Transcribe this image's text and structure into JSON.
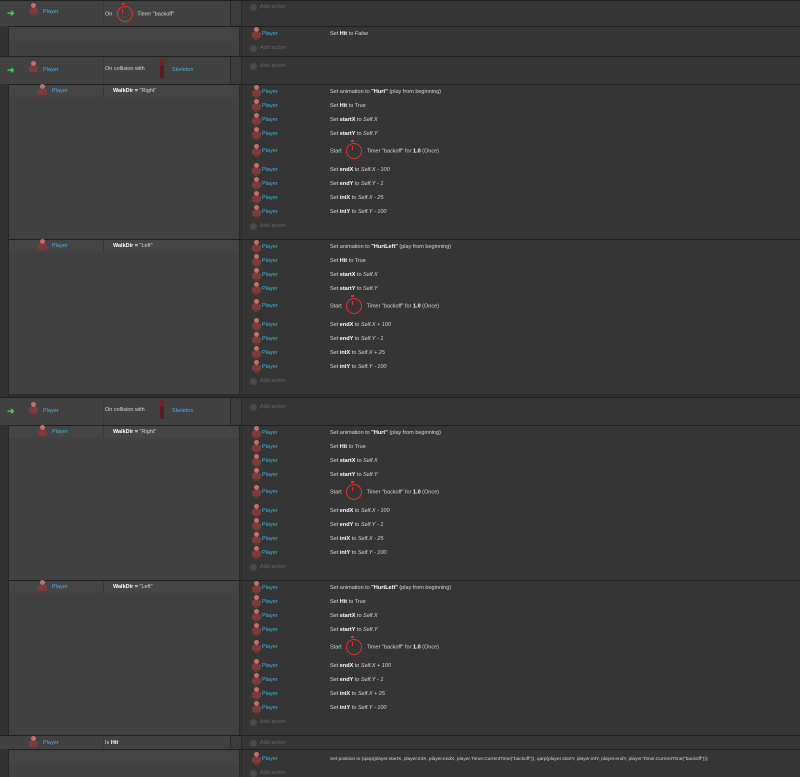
{
  "add_action": "Add action",
  "object": "Player",
  "events": [
    {
      "type": "timer",
      "on": "On",
      "timer_text": "Timer \"backoff\"",
      "actions": [],
      "subevents": [
        {
          "condition": "",
          "actions": [
            {
              "object": "Player",
              "pre": "Set ",
              "b": "Hit",
              "mid": " to ",
              "i": "False"
            }
          ]
        }
      ]
    },
    {
      "type": "collision",
      "condition": "On collision with",
      "target": "Skeleton",
      "subevents": [
        {
          "condition_pre": "WalkDir = ",
          "condition_val": "\"Right\"",
          "anim": "Hurt"
        },
        {
          "condition_pre": "WalkDir = ",
          "condition_val": "\"Left\"",
          "anim": "HurtLeft"
        }
      ]
    },
    {
      "type": "collision",
      "condition": "On collision with",
      "target": "Skeleton",
      "subevents": [
        {
          "condition_pre": "WalkDir = ",
          "condition_val": "\"Right\"",
          "anim": "Hurt"
        },
        {
          "condition_pre": "WalkDir = ",
          "condition_val": "\"Left\"",
          "anim": "HurtLeft"
        }
      ]
    }
  ],
  "right_actions": [
    {
      "pre": "Set animation to ",
      "b": "\"Hurt\"",
      "post": " (play from beginning)"
    },
    {
      "pre": "Set ",
      "b": "Hit",
      "post": " to True"
    },
    {
      "pre": "Set ",
      "b": "startX",
      "post": " to ",
      "i": "Self.X"
    },
    {
      "pre": "Set ",
      "b": "startY",
      "post": " to ",
      "i": "Self.Y"
    },
    {
      "timer": true,
      "pre": "Start ",
      "post": " Timer \"backoff\" for ",
      "b": "1.0",
      "post2": " (Once)"
    },
    {
      "pre": "Set ",
      "b": "endX",
      "post": " to ",
      "i": "Self.X - 100"
    },
    {
      "pre": "Set ",
      "b": "endY",
      "post": " to ",
      "i": "Self.Y - 1"
    },
    {
      "pre": "Set ",
      "b": "intX",
      "post": " to ",
      "i": "Self.X - 25"
    },
    {
      "pre": "Set ",
      "b": "intY",
      "post": " to ",
      "i": "Self.Y - 100"
    }
  ],
  "left_actions": [
    {
      "pre": "Set animation to ",
      "b": "\"HurtLeft\"",
      "post": " (play from beginning)"
    },
    {
      "pre": "Set ",
      "b": "Hit",
      "post": " to True"
    },
    {
      "pre": "Set ",
      "b": "startX",
      "post": " to ",
      "i": "Self.X"
    },
    {
      "pre": "Set ",
      "b": "startY",
      "post": " to ",
      "i": "Self.Y"
    },
    {
      "timer": true,
      "pre": "Start ",
      "post": " Timer \"backoff\" for ",
      "b": "1.0",
      "post2": " (Once)"
    },
    {
      "pre": "Set ",
      "b": "endX",
      "post": " to ",
      "i": "Self.X + 100"
    },
    {
      "pre": "Set ",
      "b": "endY",
      "post": " to ",
      "i": "Self.Y - 1"
    },
    {
      "pre": "Set ",
      "b": "intX",
      "post": " to ",
      "i": "Self.X + 25"
    },
    {
      "pre": "Set ",
      "b": "intY",
      "post": " to ",
      "i": "Self.Y - 100"
    }
  ],
  "last_event": {
    "condition_pre": "Is ",
    "condition_b": "Hit",
    "action": "Set position to (qarp(player.startX, player.intX, player.endX, player.Timer.CurrentTime(\"backoff\")), qarp(player.startY, player.intY, player.endY, player.Timer.CurrentTime(\"backoff\")))"
  },
  "colors": {
    "object_name": "#3fb8e6",
    "trigger_arrow": "#3cd23c",
    "timer_icon": "#e0322b"
  }
}
